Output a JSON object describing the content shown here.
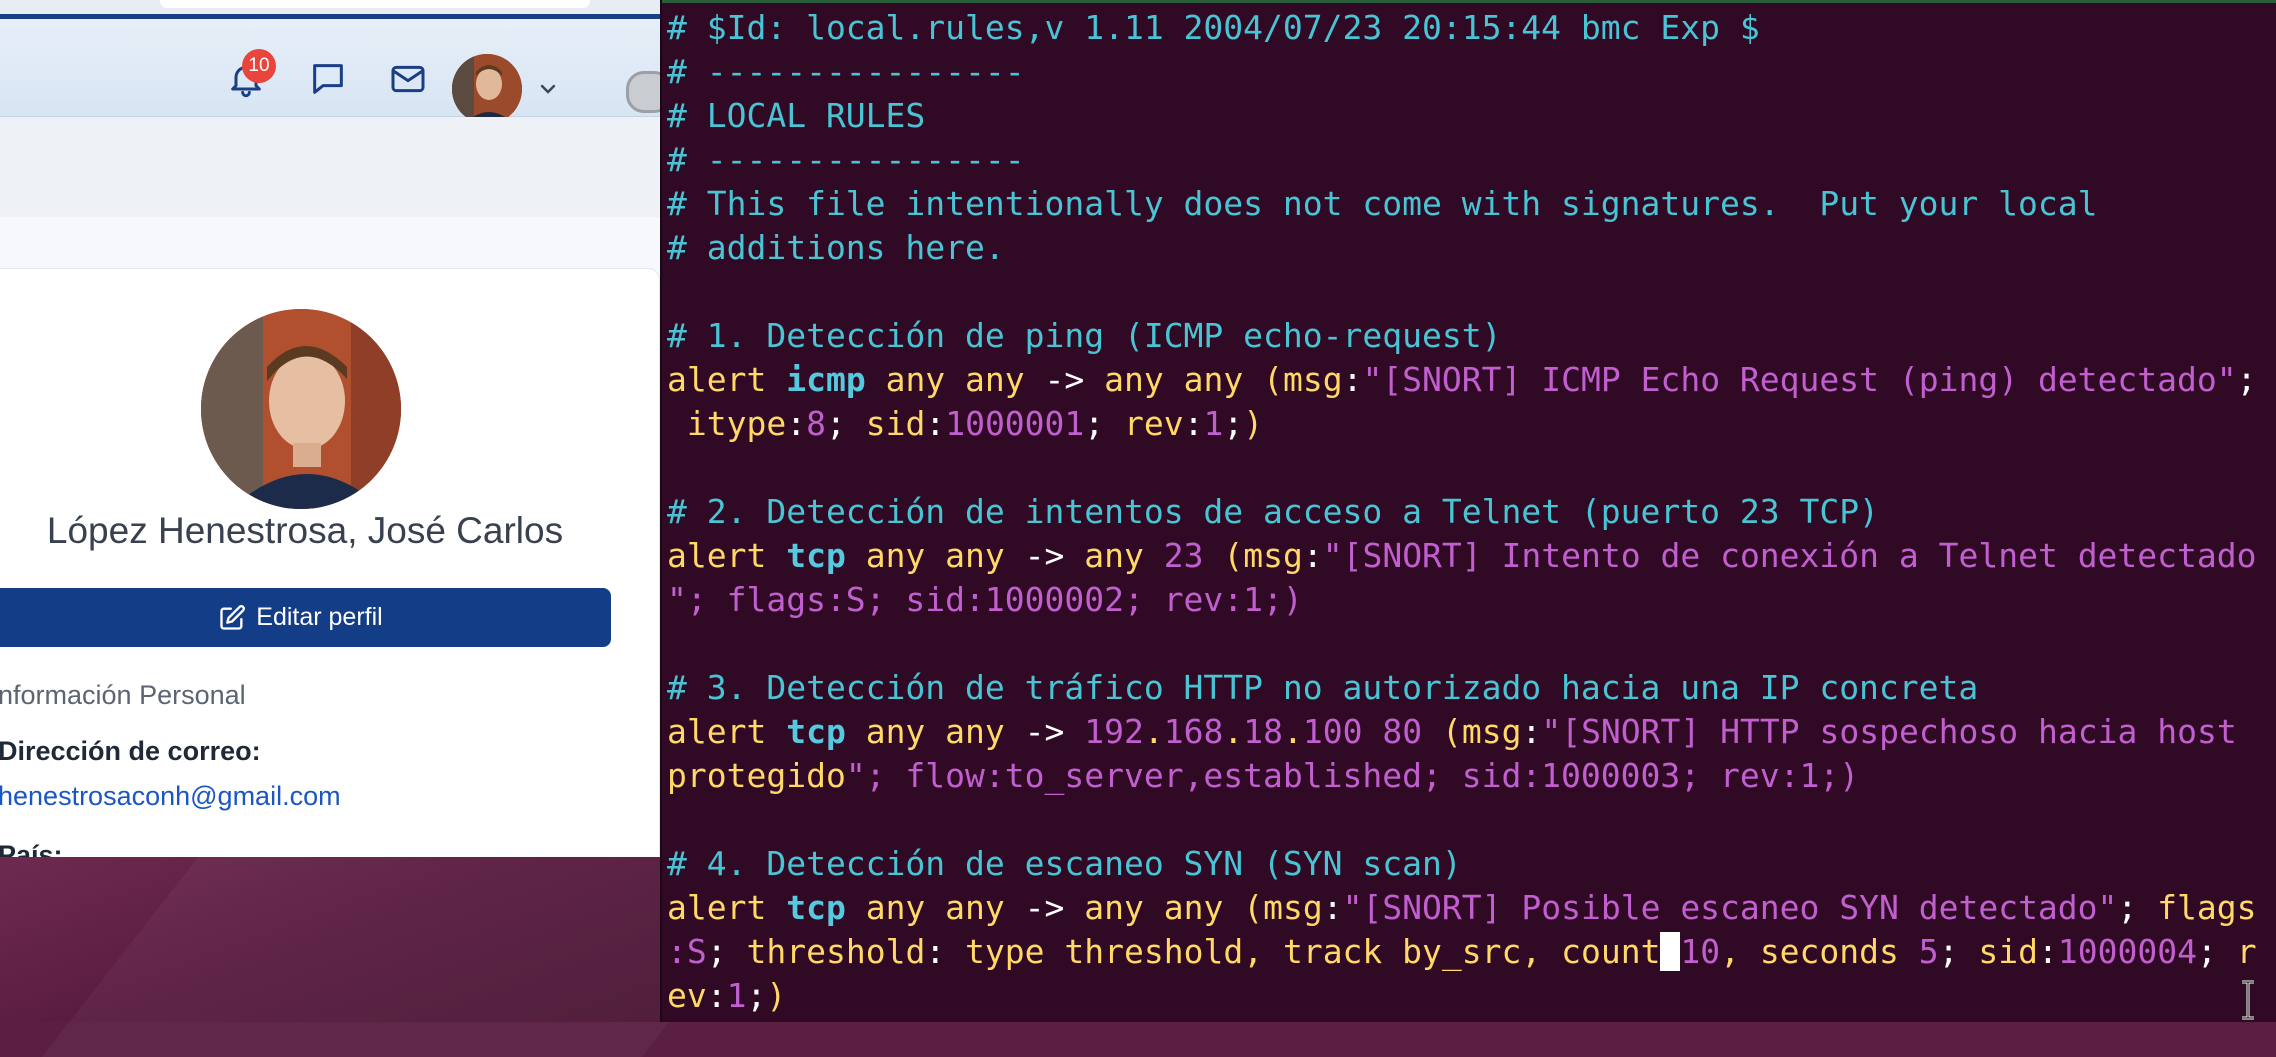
{
  "browser": {
    "nav": {
      "notification_count": "10",
      "icons": [
        "bell-icon",
        "chat-icon",
        "mail-icon",
        "chevron-down-icon"
      ]
    },
    "profile": {
      "name": "López Henestrosa, José Carlos",
      "edit_button": "Editar perfil",
      "section_title": "nformación Personal",
      "email_label": "Dirección de correo:",
      "email_value": "henestrosaconh@gmail.com",
      "country_label": "País:"
    }
  },
  "terminal": {
    "lines": [
      "# $Id: local.rules,v 1.11 2004/07/23 20:15:44 bmc Exp $",
      "# ----------------",
      "# LOCAL RULES",
      "# ----------------",
      "# This file intentionally does not come with signatures.  Put your local",
      "# additions here.",
      "",
      "# 1. Detección de ping (ICMP echo-request)",
      "alert icmp any any -> any any (msg:\"[SNORT] ICMP Echo Request (ping) detectado\";",
      " itype:8; sid:1000001; rev:1;)",
      "",
      "# 2. Detección de intentos de acceso a Telnet (puerto 23 TCP)",
      "alert tcp any any -> any 23 (msg:\"[SNORT] Intento de conexión a Telnet detectado",
      "\"; flags:S; sid:1000002; rev:1;)",
      "",
      "# 3. Detección de tráfico HTTP no autorizado hacia una IP concreta",
      "alert tcp any any -> 192.168.18.100 80 (msg:\"[SNORT] HTTP sospechoso hacia host",
      "protegido\"; flow:to_server,established; sid:1000003; rev:1;)",
      "",
      "# 4. Detección de escaneo SYN (SYN scan)",
      "alert tcp any any -> any any (msg:\"[SNORT] Posible escaneo SYN detectado\"; flags",
      ":S; threshold: type threshold, track by_src, count 10, seconds 5; sid:1000004; r",
      "ev:1;)"
    ],
    "colors": {
      "background": "#300a24",
      "comment": "#48c4d4",
      "keyword": "#ffd866",
      "protocol": "#56c8e0",
      "string": "#c25fd0"
    }
  }
}
